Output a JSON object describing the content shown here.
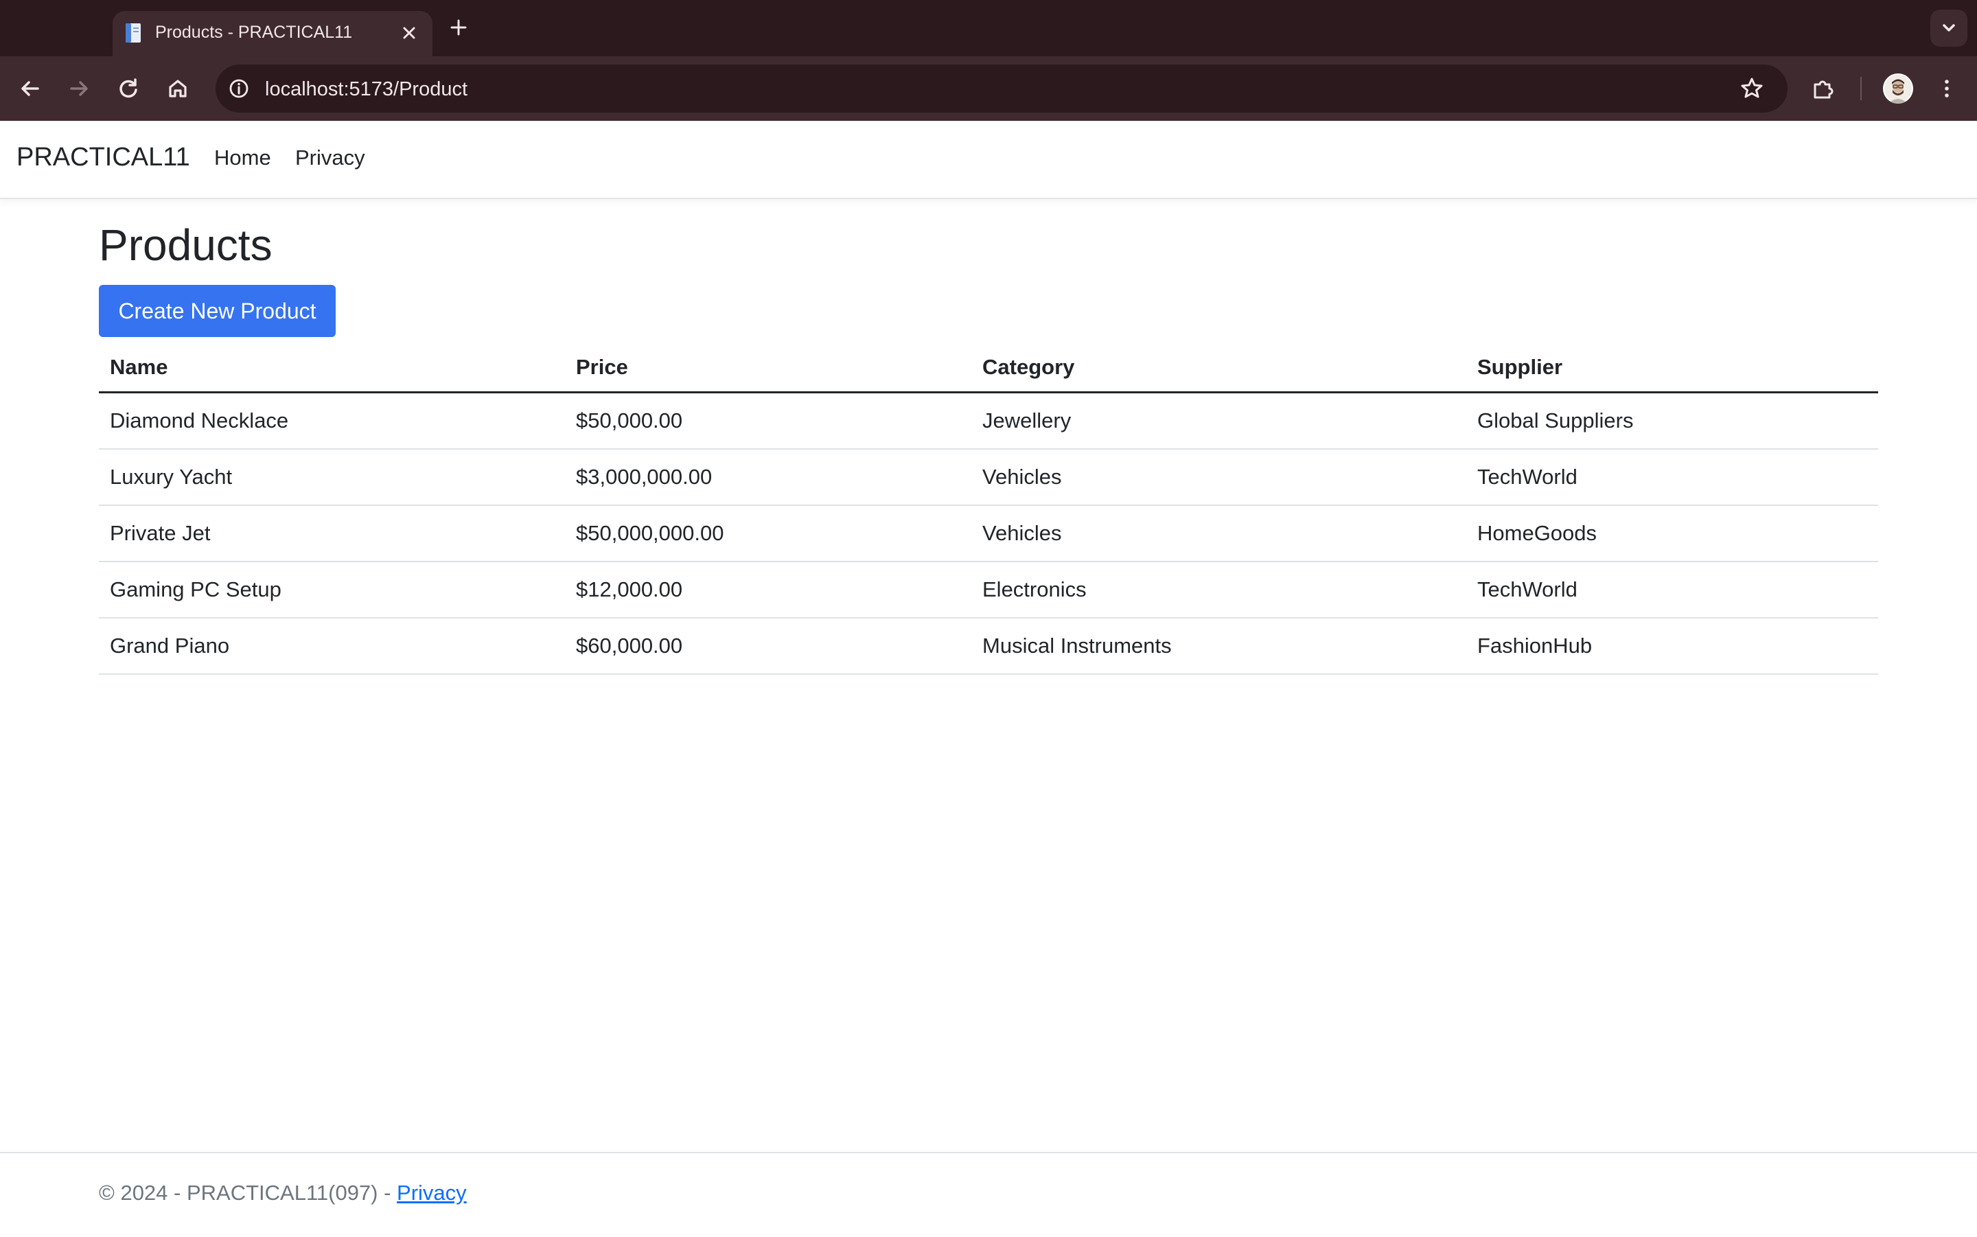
{
  "browser": {
    "tab_title": "Products - PRACTICAL11",
    "url": "localhost:5173/Product"
  },
  "navbar": {
    "brand": "PRACTICAL11",
    "links": [
      "Home",
      "Privacy"
    ]
  },
  "main": {
    "title": "Products",
    "create_button": "Create New Product",
    "table": {
      "headers": [
        "Name",
        "Price",
        "Category",
        "Supplier"
      ],
      "rows": [
        [
          "Diamond Necklace",
          "$50,000.00",
          "Jewellery",
          "Global Suppliers"
        ],
        [
          "Luxury Yacht",
          "$3,000,000.00",
          "Vehicles",
          "TechWorld"
        ],
        [
          "Private Jet",
          "$50,000,000.00",
          "Vehicles",
          "HomeGoods"
        ],
        [
          "Gaming PC Setup",
          "$12,000.00",
          "Electronics",
          "TechWorld"
        ],
        [
          "Grand Piano",
          "$60,000.00",
          "Musical Instruments",
          "FashionHub"
        ]
      ]
    }
  },
  "footer": {
    "text": "© 2024 - PRACTICAL11(097) - ",
    "link": "Privacy"
  },
  "colors": {
    "chrome_dark": "#2b191e",
    "chrome_toolbar": "#3e2a2f",
    "primary_button": "#3573f0",
    "link": "#0d6efd"
  },
  "icons": [
    "page-favicon-icon",
    "close-icon",
    "plus-icon",
    "chevron-down-icon",
    "back-arrow-icon",
    "forward-arrow-icon",
    "reload-icon",
    "home-icon",
    "info-icon",
    "star-icon",
    "extensions-icon",
    "profile-avatar-icon",
    "more-vert-icon"
  ]
}
